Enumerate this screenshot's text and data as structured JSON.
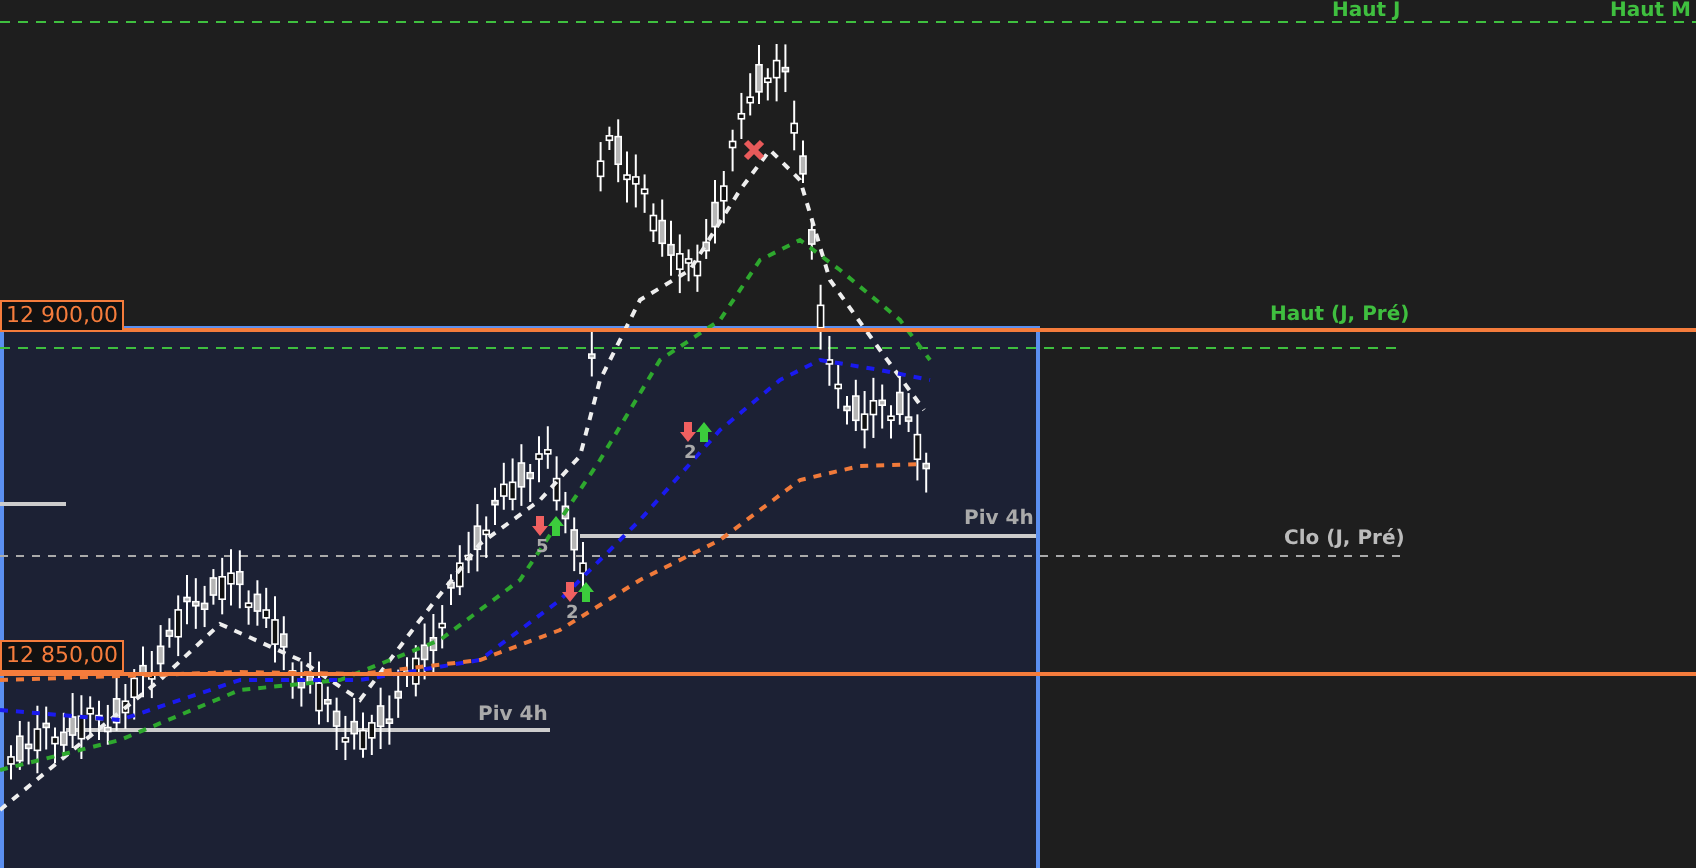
{
  "price_labels": [
    {
      "text": "12 900,00"
    },
    {
      "text": "12 850,00"
    }
  ],
  "line_labels": [
    {
      "text": "Haut J",
      "kind": "high"
    },
    {
      "text": "Haut M",
      "kind": "high"
    },
    {
      "text": "Haut (J, Pré)",
      "kind": "high"
    },
    {
      "text": "Piv 4h",
      "kind": "pivot"
    },
    {
      "text": "Clo (J, Pré)",
      "kind": "close"
    },
    {
      "text": "Piv 4h",
      "kind": "pivot"
    }
  ],
  "signals": [
    {
      "count": "5"
    },
    {
      "count": "2"
    },
    {
      "count": "2"
    }
  ]
}
